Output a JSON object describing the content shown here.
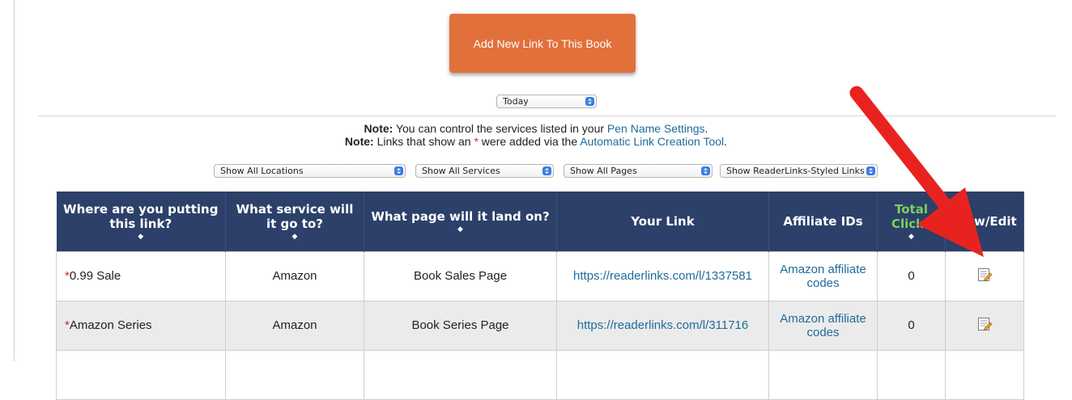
{
  "add_button": {
    "label": "Add New Link To This Book"
  },
  "date_filter": {
    "value": "Today"
  },
  "notes": {
    "note1_label": "Note:",
    "note1_text": " You can control the services listed in your ",
    "note1_link": "Pen Name Settings",
    "note1_end": ".",
    "note2_label": "Note:",
    "note2_text": " Links that show an ",
    "note2_star": "*",
    "note2_mid": " were added via the ",
    "note2_link": "Automatic Link Creation Tool",
    "note2_end": "."
  },
  "filters": {
    "locations": "Show All Locations",
    "services": "Show All Services",
    "pages": "Show All Pages",
    "styled": "Show ReaderLinks-Styled Links"
  },
  "table": {
    "headers": {
      "location": "Where are you putting this link?",
      "service": "What service will it go to?",
      "page": "What page will it land on?",
      "link": "Your Link",
      "affiliate": "Affiliate IDs",
      "clicks": "Total Clicks",
      "view_edit": "View/Edit"
    },
    "rows": [
      {
        "star": "*",
        "location": "0.99 Sale",
        "service": "Amazon",
        "page": "Book Sales Page",
        "link": "https://readerlinks.com/l/1337581",
        "affiliate": "Amazon affiliate codes",
        "clicks": "0"
      },
      {
        "star": "*",
        "location": "Amazon Series",
        "service": "Amazon",
        "page": "Book Series Page",
        "link": "https://readerlinks.com/l/311716",
        "affiliate": "Amazon affiliate codes",
        "clicks": "0"
      }
    ]
  },
  "colors": {
    "button": "#e2703a",
    "header": "#2c4069",
    "link": "#1f6b9a",
    "arrow": "#e8231f",
    "clicks_header": "#7cd05a"
  },
  "icons": {
    "edit": "edit-icon",
    "arrow": "red-arrow-annotation"
  }
}
